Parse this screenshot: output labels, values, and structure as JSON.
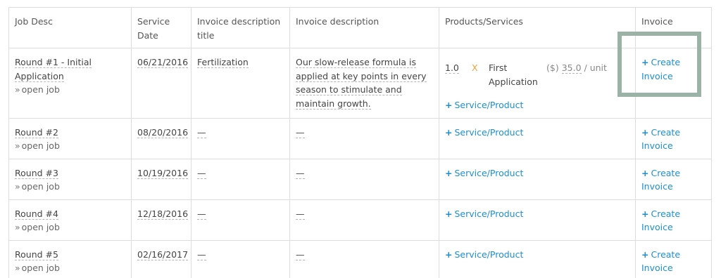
{
  "headers": [
    "Job Desc",
    "Service Date",
    "Invoice description title",
    "Invoice description",
    "Products/Services",
    "Invoice"
  ],
  "labels": {
    "open_job": "open job",
    "raquo": "»",
    "add_product": "Service/Product",
    "create_invoice": "Create Invoice",
    "empty": "—",
    "times": "X",
    "plus": "+"
  },
  "rows": [
    {
      "job": "Round #1 - Initial Application",
      "date": "06/21/2016",
      "title": "Fertilization",
      "description": "Our slow-release formula is applied at key points in every season to stimulate and maintain growth.",
      "product": {
        "qty": "1.0",
        "name": "First Application",
        "price_prefix": "($)",
        "price": "35.0",
        "unit": "/ unit"
      }
    },
    {
      "job": "Round #2",
      "date": "08/20/2016",
      "title": "—",
      "description": "—"
    },
    {
      "job": "Round #3",
      "date": "10/19/2016",
      "title": "—",
      "description": "—"
    },
    {
      "job": "Round #4",
      "date": "12/18/2016",
      "title": "—",
      "description": "—"
    },
    {
      "job": "Round #5",
      "date": "02/16/2017",
      "title": "—",
      "description": "—"
    }
  ],
  "colors": {
    "link": "#1b8fd1",
    "multiplier": "#f0a23b",
    "highlight": "#9ab3a6",
    "border": "#dddddd"
  },
  "icons": {
    "plus": "plus-icon",
    "raquo": "double-chevron-right-icon"
  }
}
